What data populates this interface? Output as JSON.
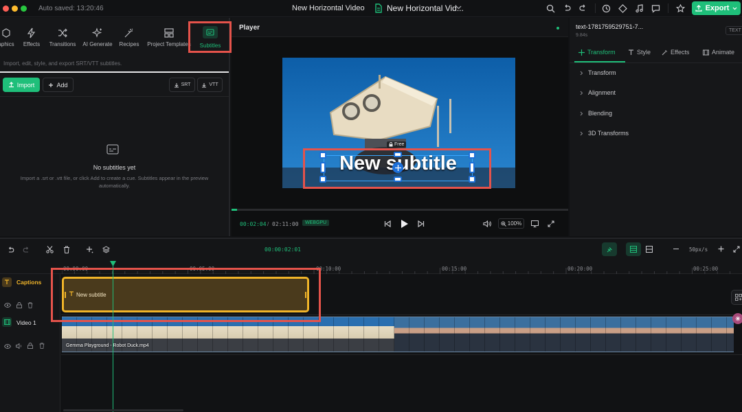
{
  "topbar": {
    "autosave": "Auto saved: 13:20:46",
    "project_title": "New Horizontal Video",
    "doc_title": "New Horizontal Vid...",
    "export_label": "Export"
  },
  "left_panel": {
    "tools": [
      {
        "label": "aphics",
        "icon": "graphics-icon"
      },
      {
        "label": "Effects",
        "icon": "lightning-icon"
      },
      {
        "label": "Transitions",
        "icon": "shuffle-icon"
      },
      {
        "label": "AI Generate",
        "icon": "sparkle-icon"
      },
      {
        "label": "Recipes",
        "icon": "wand-icon"
      },
      {
        "label": "Project Templates",
        "icon": "template-icon"
      },
      {
        "label": "Subtitles",
        "icon": "subtitles-icon"
      }
    ],
    "hint": "Import, edit, style, and export SRT/VTT subtitles.",
    "import_label": "Import",
    "add_label": "Add",
    "srt_label": "SRT",
    "vtt_label": "VTT",
    "empty_title": "No subtitles yet",
    "empty_desc": "Import a .srt or .vtt file, or click Add to create a cue. Subtitles appear in the preview automatically."
  },
  "player": {
    "label": "Player",
    "subtitle_text": "New subtitle",
    "lock_label": "Free",
    "current_time": "00:02:04",
    "time_sep": "/",
    "total_time": "02:11:00",
    "renderer_badge": "WEBGPU",
    "zoom": "100%",
    "progress": 0.016
  },
  "right_panel": {
    "clip_name": "text-1781759529751-7...",
    "clip_duration": "9.84s",
    "badge": "TEXT",
    "tabs": [
      "Transform",
      "Style",
      "Effects",
      "Animate"
    ],
    "sections": [
      "Transform",
      "Alignment",
      "Blending",
      "3D Transforms"
    ]
  },
  "timeline": {
    "timecode": "00:00:02:01",
    "zoom_label": "50px/s",
    "ruler": [
      "00:00:00",
      "00:05:00",
      "00:10:00",
      "00:15:00",
      "00:20:00",
      "00:25:00"
    ],
    "tracks": [
      {
        "name": "Captions",
        "clip": "New subtitle"
      },
      {
        "name": "Video 1",
        "clip": "Gemma Playground - Robot Duck.mp4"
      }
    ]
  },
  "colors": {
    "accent": "#1fbf7a",
    "caption_clip": "#f0b429",
    "highlight": "#e5534b"
  }
}
